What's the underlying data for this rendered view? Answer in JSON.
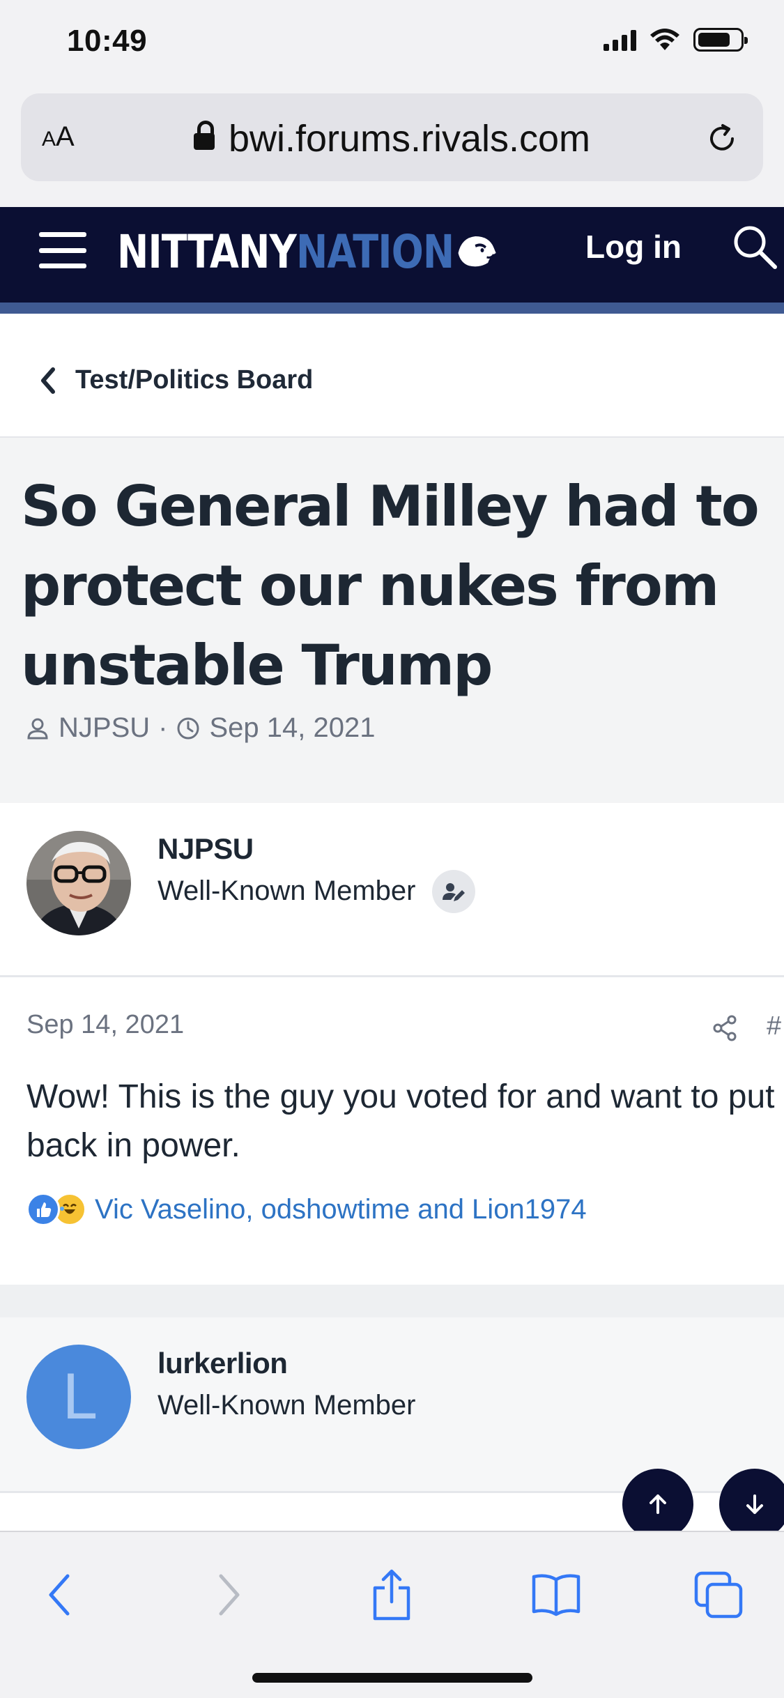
{
  "status_bar": {
    "time": "10:49"
  },
  "browser": {
    "text_size_label_small": "A",
    "text_size_label_large": "A",
    "url": "bwi.forums.rivals.com"
  },
  "site_header": {
    "logo_part1": "NITTANY",
    "logo_part2": "NATION",
    "login_label": "Log in"
  },
  "breadcrumb": {
    "label": "Test/Politics Board"
  },
  "thread": {
    "title": "So General Milley had to protect our nukes from unstable Trump",
    "author": "NJPSU",
    "separator": "·",
    "date": "Sep 14, 2021"
  },
  "posts": [
    {
      "username": "NJPSU",
      "user_title": "Well-Known Member",
      "date": "Sep 14, 2021",
      "post_number_label": "#",
      "text": "Wow! This is the guy you voted for and want to put back in power.",
      "reactions_text": "Vic Vaselino, odshowtime and Lion1974"
    },
    {
      "username": "lurkerlion",
      "user_title": "Well-Known Member",
      "avatar_letter": "L"
    }
  ],
  "colors": {
    "header_bg": "#0b0f33",
    "header_accent": "#3f5a92",
    "logo_blue": "#3d6bb5",
    "link_blue": "#2d73c4",
    "toolbar_blue": "#3478f6"
  }
}
